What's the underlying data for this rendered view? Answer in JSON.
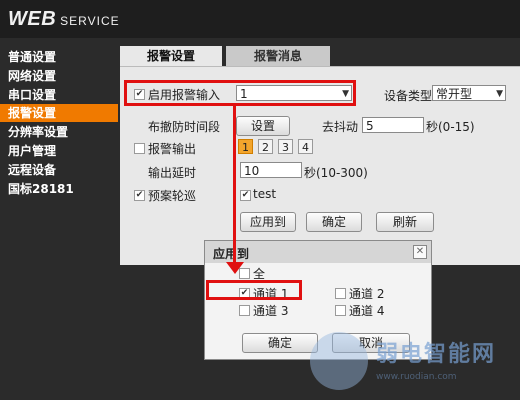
{
  "brand": {
    "web": "WEB",
    "service": "SERVICE"
  },
  "sidebar": {
    "items": [
      {
        "label": "普通设置"
      },
      {
        "label": "网络设置"
      },
      {
        "label": "串口设置"
      },
      {
        "label": "报警设置"
      },
      {
        "label": "分辨率设置"
      },
      {
        "label": "用户管理"
      },
      {
        "label": "远程设备"
      },
      {
        "label": "国标28181"
      }
    ]
  },
  "tabs": [
    {
      "label": "报警设置"
    },
    {
      "label": "报警消息"
    }
  ],
  "form": {
    "enable_input_label": "启用报警输入",
    "enable_input_checked": "✔",
    "input_select_value": "1",
    "device_type_label": "设备类型",
    "device_type_value": "常开型",
    "arm_period_label": "布撤防时间段",
    "setup_button": "设置",
    "debounce_label": "去抖动",
    "debounce_value": "5",
    "debounce_unit": "秒(0-15)",
    "alarm_output_label": "报警输出",
    "output_numbers": [
      "1",
      "2",
      "3",
      "4"
    ],
    "output_delay_label": "输出延时",
    "output_delay_value": "10",
    "output_delay_unit": "秒(10-300)",
    "preset_tour_label": "预案轮巡",
    "preset_tour_checked": "✔",
    "test_label": "test",
    "test_checked": "✔",
    "apply_to_button": "应用到",
    "ok_button": "确定",
    "refresh_button": "刷新"
  },
  "dialog": {
    "title": "应用到",
    "close": "✕",
    "all_label": "全",
    "channels": [
      {
        "label": "通道 1",
        "checked": "✔"
      },
      {
        "label": "通道 2",
        "checked": ""
      },
      {
        "label": "通道 3",
        "checked": ""
      },
      {
        "label": "通道 4",
        "checked": ""
      }
    ],
    "ok_button": "确定",
    "cancel_button": "取消"
  },
  "watermark": {
    "text": "弱电智能网",
    "sub": "www.ruodian.com"
  },
  "colors": {
    "accent": "#f07a00",
    "highlight": "#e01010"
  }
}
